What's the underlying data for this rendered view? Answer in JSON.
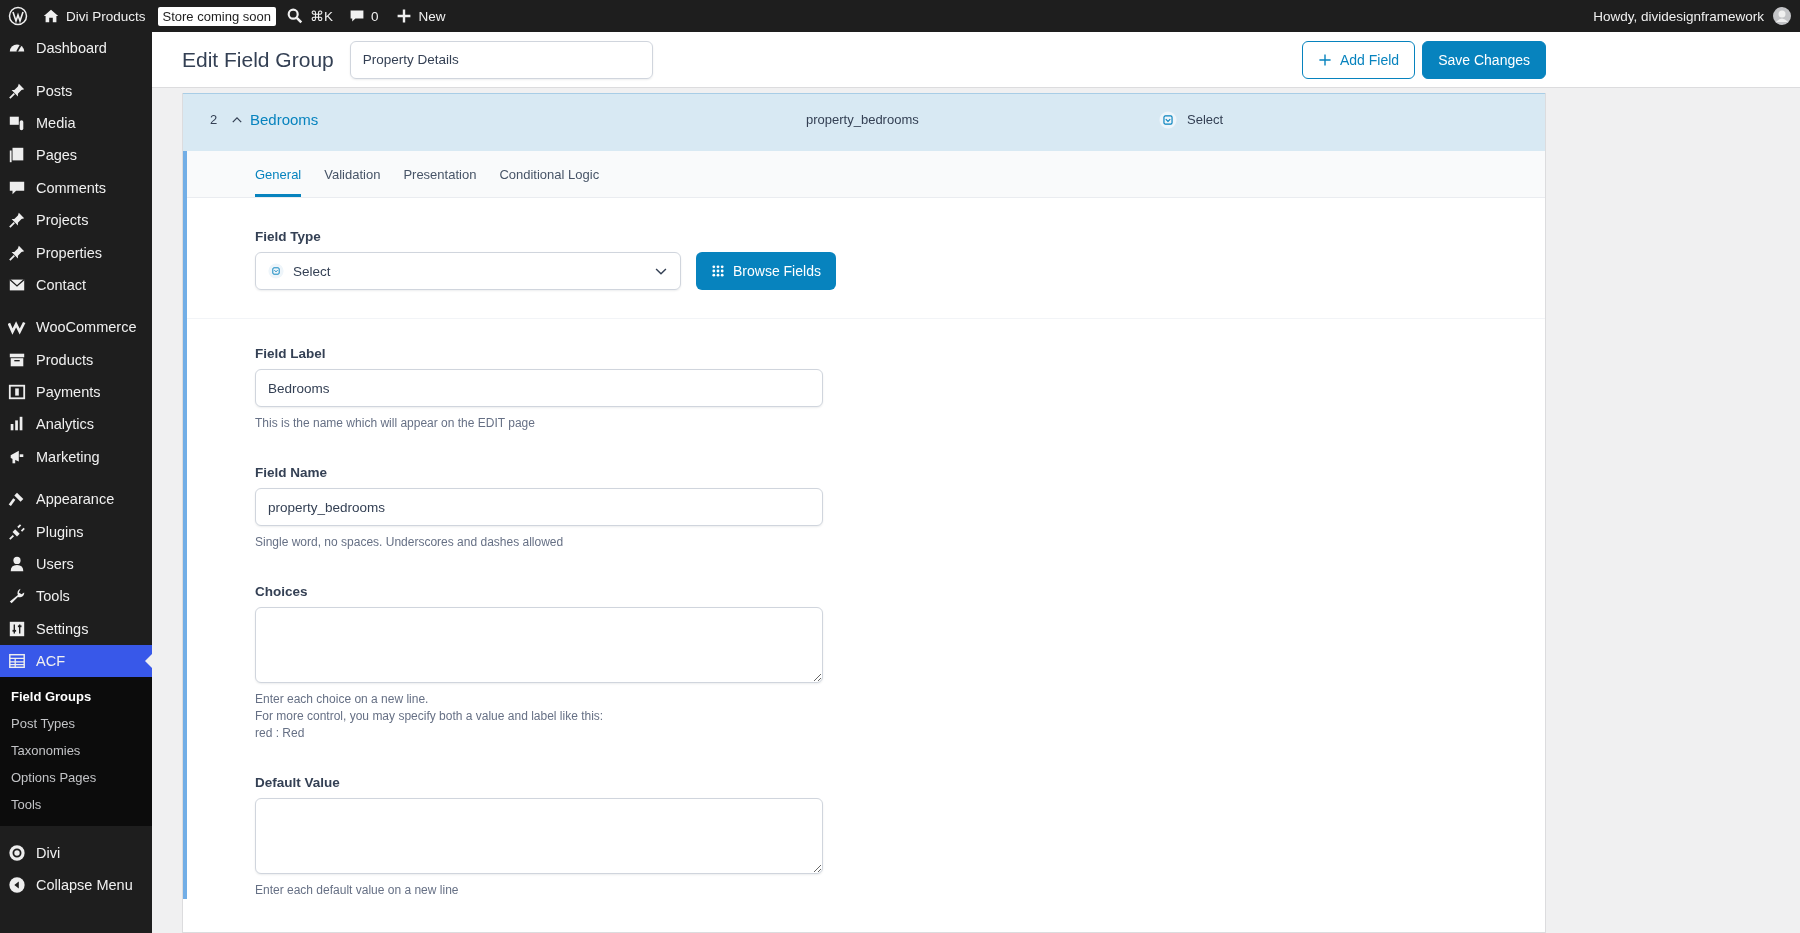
{
  "admin_bar": {
    "site_name": "Divi Products",
    "badge": "Store coming soon",
    "shortcut": "⌘K",
    "comment_count": "0",
    "new_label": "New",
    "greeting": "Howdy, dividesignframework"
  },
  "sidebar": {
    "sections": [
      {
        "items": [
          {
            "label": "Dashboard",
            "selected": false
          }
        ]
      },
      {
        "items": [
          {
            "label": "Posts",
            "selected": false
          },
          {
            "label": "Media",
            "selected": false
          },
          {
            "label": "Pages",
            "selected": false
          },
          {
            "label": "Comments",
            "selected": false
          },
          {
            "label": "Projects",
            "selected": false
          },
          {
            "label": "Properties",
            "selected": false
          },
          {
            "label": "Contact",
            "selected": false
          }
        ]
      },
      {
        "items": [
          {
            "label": "WooCommerce",
            "selected": false
          },
          {
            "label": "Products",
            "selected": false
          },
          {
            "label": "Payments",
            "selected": false
          },
          {
            "label": "Analytics",
            "selected": false
          },
          {
            "label": "Marketing",
            "selected": false
          }
        ]
      },
      {
        "items": [
          {
            "label": "Appearance",
            "selected": false
          },
          {
            "label": "Plugins",
            "selected": false
          },
          {
            "label": "Users",
            "selected": false
          },
          {
            "label": "Tools",
            "selected": false
          },
          {
            "label": "Settings",
            "selected": false
          },
          {
            "label": "ACF",
            "selected": true,
            "children": [
              {
                "label": "Field Groups",
                "selected": true
              },
              {
                "label": "Post Types",
                "selected": false
              },
              {
                "label": "Taxonomies",
                "selected": false
              },
              {
                "label": "Options Pages",
                "selected": false
              },
              {
                "label": "Tools",
                "selected": false
              }
            ]
          }
        ]
      },
      {
        "items": [
          {
            "label": "Divi",
            "selected": false
          },
          {
            "label": "Collapse Menu",
            "selected": false
          }
        ]
      }
    ]
  },
  "header": {
    "title": "Edit Field Group",
    "title_value": "Property Details",
    "buttons": [
      {
        "label": "Add Field",
        "kind": "secondary"
      },
      {
        "label": "Save Changes",
        "kind": "primary"
      }
    ]
  },
  "field_row": {
    "order": "2",
    "label": "Bedrooms",
    "name": "property_bedrooms",
    "type": "Select",
    "expanded": true
  },
  "tabs": [
    {
      "label": "General",
      "selected": true
    },
    {
      "label": "Validation",
      "selected": false
    },
    {
      "label": "Presentation",
      "selected": false
    },
    {
      "label": "Conditional Logic",
      "selected": false
    }
  ],
  "field_type": {
    "label": "Field Type",
    "value": "Select",
    "button": "Browse Fields"
  },
  "settings": [
    {
      "kind": "input",
      "label": "Field Label",
      "value": "Bedrooms",
      "help": [
        "This is the name which will appear on the EDIT page"
      ]
    },
    {
      "kind": "input",
      "label": "Field Name",
      "value": "property_bedrooms",
      "help": [
        "Single word, no spaces. Underscores and dashes allowed"
      ]
    },
    {
      "kind": "textarea",
      "label": "Choices",
      "help": [
        "Enter each choice on a new line.",
        "For more control, you may specify both a value and label like this:",
        "red : Red"
      ]
    },
    {
      "kind": "textarea",
      "label": "Default Value",
      "help": [
        "Enter each default value on a new line"
      ]
    }
  ]
}
